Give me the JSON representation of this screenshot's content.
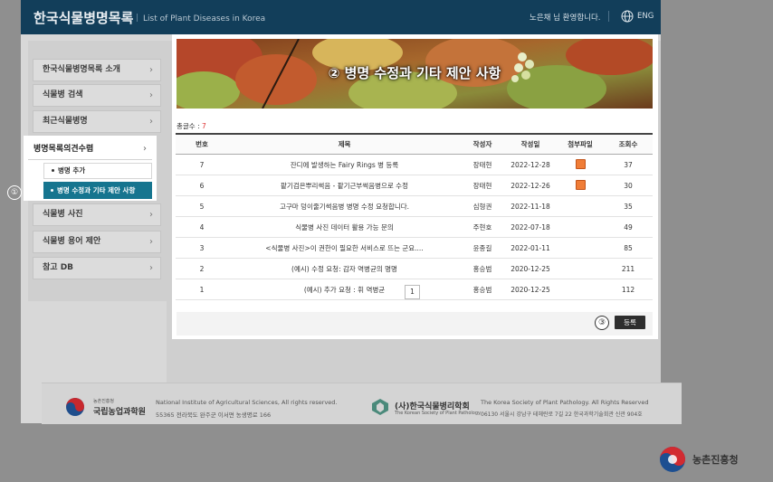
{
  "header": {
    "title": "한국식물병명목록",
    "subtitle": "List of Plant Diseases in Korea",
    "welcome": "노은채 님 환영합니다.",
    "language": "ENG"
  },
  "sidebar": {
    "items": [
      {
        "label": "한국식물병명목록 소개"
      },
      {
        "label": "식물병 검색"
      },
      {
        "label": "최근식물병명"
      },
      {
        "label": "병명목록의견수렴"
      },
      {
        "label": "식물병 사진"
      },
      {
        "label": "식물병 용어 제안"
      },
      {
        "label": "참고 DB"
      }
    ],
    "subitems": [
      {
        "label": "병명 추가"
      },
      {
        "label": "병명 수정과 기타 제안 사항"
      }
    ],
    "chevron": "›"
  },
  "markers": {
    "m1": "①",
    "m2": "②",
    "m3": "③"
  },
  "banner": {
    "title": "병명 수정과 기타 제안 사항"
  },
  "board": {
    "total_label": "총글수 : ",
    "total_count": "7",
    "columns": [
      "번호",
      "제목",
      "작성자",
      "작성일",
      "첨부파일",
      "조회수"
    ],
    "rows": [
      {
        "no": "7",
        "title": "잔디에 발생하는 Fairy Rings 병 등록",
        "author": "장태현",
        "date": "2022-12-28",
        "attachment": true,
        "views": "37"
      },
      {
        "no": "6",
        "title": "팥기검은뿌리썩음 - 팥기근부썩음병으로 수정",
        "author": "장태현",
        "date": "2022-12-26",
        "attachment": true,
        "views": "30"
      },
      {
        "no": "5",
        "title": "고구마 덩이줄기썩음병 병명 수정 요청합니다.",
        "author": "심형권",
        "date": "2022-11-18",
        "attachment": false,
        "views": "35"
      },
      {
        "no": "4",
        "title": "식물병 사진 데이터 활용 가능 문의",
        "author": "주현호",
        "date": "2022-07-18",
        "attachment": false,
        "views": "49"
      },
      {
        "no": "3",
        "title": "<식물병 사진>이 권한이 필요한 서비스로 뜨는 군요....",
        "author": "윤종길",
        "date": "2022-01-11",
        "attachment": false,
        "views": "85"
      },
      {
        "no": "2",
        "title": "(예시) 수정 요청: 감자 역병균의 명명",
        "author": "홍승범",
        "date": "2020-12-25",
        "attachment": false,
        "views": "211"
      },
      {
        "no": "1",
        "title": "(예시) 추가 요청 : 휘 역병균",
        "author": "홍승범",
        "date": "2020-12-25",
        "attachment": false,
        "views": "112"
      }
    ],
    "page": "1",
    "register_label": "등록"
  },
  "footer": {
    "naas_small": "농촌진흥청",
    "naas_name": "국립농업과학원",
    "naas_copyright": "National Institute of Agricultural Sciences, All rights reserved.",
    "naas_address": "55365 전라북도 완주군 이서면 농생명로 166",
    "kspp_name": "(사)한국식물병리학회",
    "kspp_sub": "The Korean Society of Plant Pathology",
    "kspp_copyright": "The Korea Society of Plant Pathology. All Rights Reserved",
    "kspp_address": "06130 서울시 강남구 테헤란로 7길 22 한국과학기술회관 신관 904호"
  },
  "rda": {
    "name": "농촌진흥청"
  },
  "colors": {
    "header": "#123e5a",
    "accent": "#16758f",
    "button": "#2e2e2e",
    "count": "#dd3333"
  }
}
